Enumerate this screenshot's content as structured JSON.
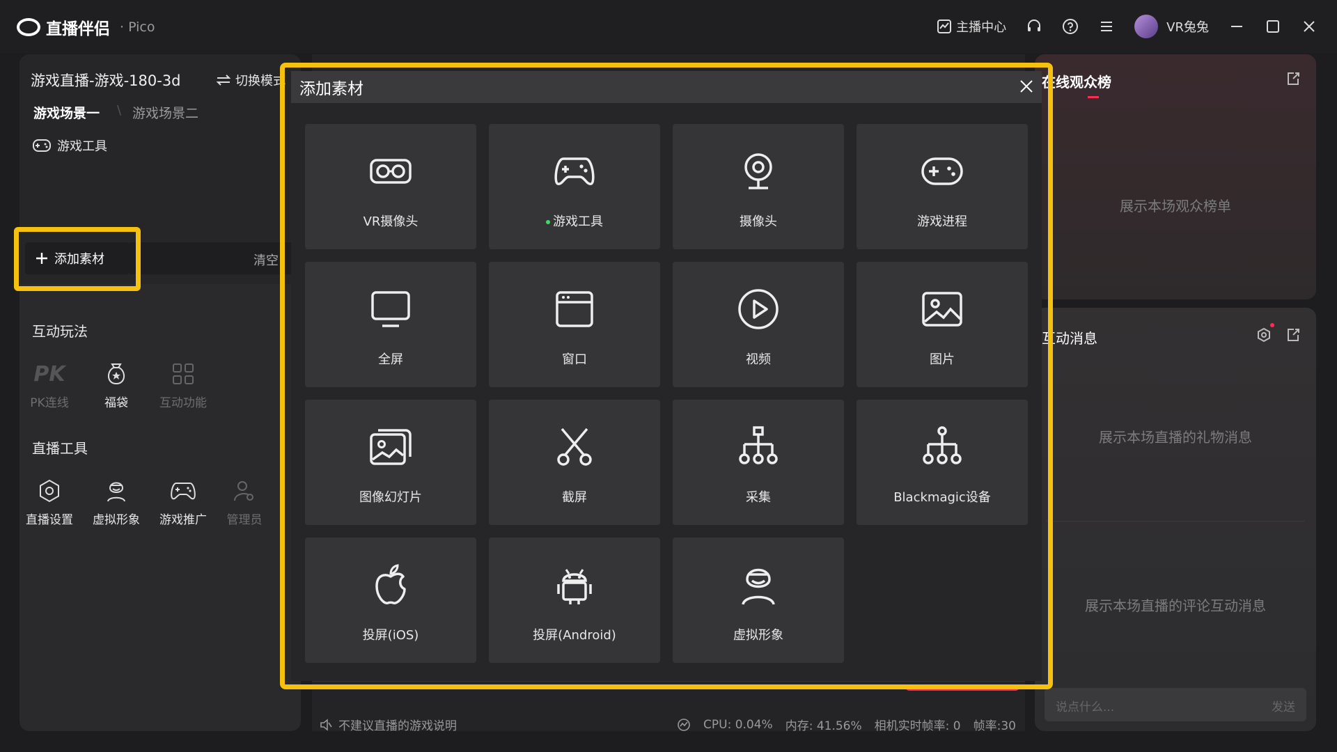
{
  "app": {
    "name": "直播伴侣",
    "sub": "· Pico"
  },
  "header": {
    "host_center": "主播中心",
    "username": "VR兔兔"
  },
  "left": {
    "stream_title": "游戏直播-游戏-180-3d",
    "switch_mode": "切换模式",
    "scene1": "游戏场景一",
    "scene2": "游戏场景二",
    "source_item": "游戏工具",
    "add_material": "添加素材",
    "clear": "清空",
    "interactive_title": "互动玩法",
    "interactive": [
      {
        "label": "PK连线"
      },
      {
        "label": "福袋"
      },
      {
        "label": "互动功能"
      }
    ],
    "tools_title": "直播工具",
    "tools": [
      {
        "label": "直播设置"
      },
      {
        "label": "虚拟形象"
      },
      {
        "label": "游戏推广"
      },
      {
        "label": "管理员"
      }
    ]
  },
  "right": {
    "audience_title": "在线观众榜",
    "audience_empty": "展示本场观众榜单",
    "messages_title": "互动消息",
    "gifts_empty": "展示本场直播的礼物消息",
    "comments_empty": "展示本场直播的评论互动消息",
    "input_placeholder": "说点什么...",
    "send": "发送"
  },
  "status": {
    "game_note": "不建议直播的游戏说明",
    "cpu": "CPU: 0.04%",
    "mem": "内存: 41.56%",
    "cam_fps": "相机实时帧率: 0",
    "fps": "帧率:30"
  },
  "modal": {
    "title": "添加素材",
    "tiles": [
      {
        "label": "VR摄像头",
        "icon": "vr-headset-icon"
      },
      {
        "label": "游戏工具",
        "icon": "gamepad-icon",
        "active": true
      },
      {
        "label": "摄像头",
        "icon": "webcam-icon"
      },
      {
        "label": "游戏进程",
        "icon": "game-controller-icon"
      },
      {
        "label": "全屏",
        "icon": "monitor-icon"
      },
      {
        "label": "窗口",
        "icon": "window-icon"
      },
      {
        "label": "视频",
        "icon": "play-icon"
      },
      {
        "label": "图片",
        "icon": "image-icon"
      },
      {
        "label": "图像幻灯片",
        "icon": "slideshow-icon"
      },
      {
        "label": "截屏",
        "icon": "scissors-icon"
      },
      {
        "label": "采集",
        "icon": "capture-tree-icon"
      },
      {
        "label": "Blackmagic设备",
        "icon": "blackmagic-icon"
      },
      {
        "label": "投屏(iOS)",
        "icon": "apple-icon"
      },
      {
        "label": "投屏(Android)",
        "icon": "android-icon"
      },
      {
        "label": "虚拟形象",
        "icon": "avatar-icon"
      }
    ]
  },
  "colors": {
    "highlight": "#f6c10e",
    "accent": "#fe2c55",
    "active_dot": "#3ddc63"
  }
}
